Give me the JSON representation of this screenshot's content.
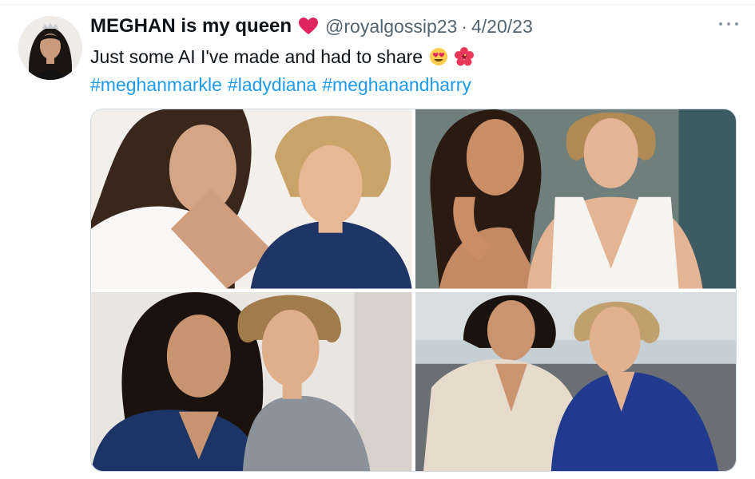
{
  "tweet": {
    "display_name": "MEGHAN is my queen",
    "name_emoji": "heart",
    "handle": "@royalgossip23",
    "separator": "·",
    "date": "4/20/23",
    "text": "Just some AI I've made and had to share",
    "text_emojis": [
      "heart-eyes-face",
      "hibiscus"
    ],
    "hashtags": [
      "#meghanmarkle",
      "#ladydiana",
      "#meghanandharry"
    ]
  },
  "media": {
    "count": 4,
    "images": [
      "ai-portrait-1",
      "ai-portrait-2",
      "ai-portrait-3",
      "ai-portrait-4"
    ]
  },
  "colors": {
    "link": "#1d9bf0",
    "secondary_text": "#536471",
    "primary_text": "#0f1419",
    "heart": "#e0245e",
    "border": "#cfd9de"
  },
  "icons": {
    "more": "more-horizontal-icon"
  }
}
